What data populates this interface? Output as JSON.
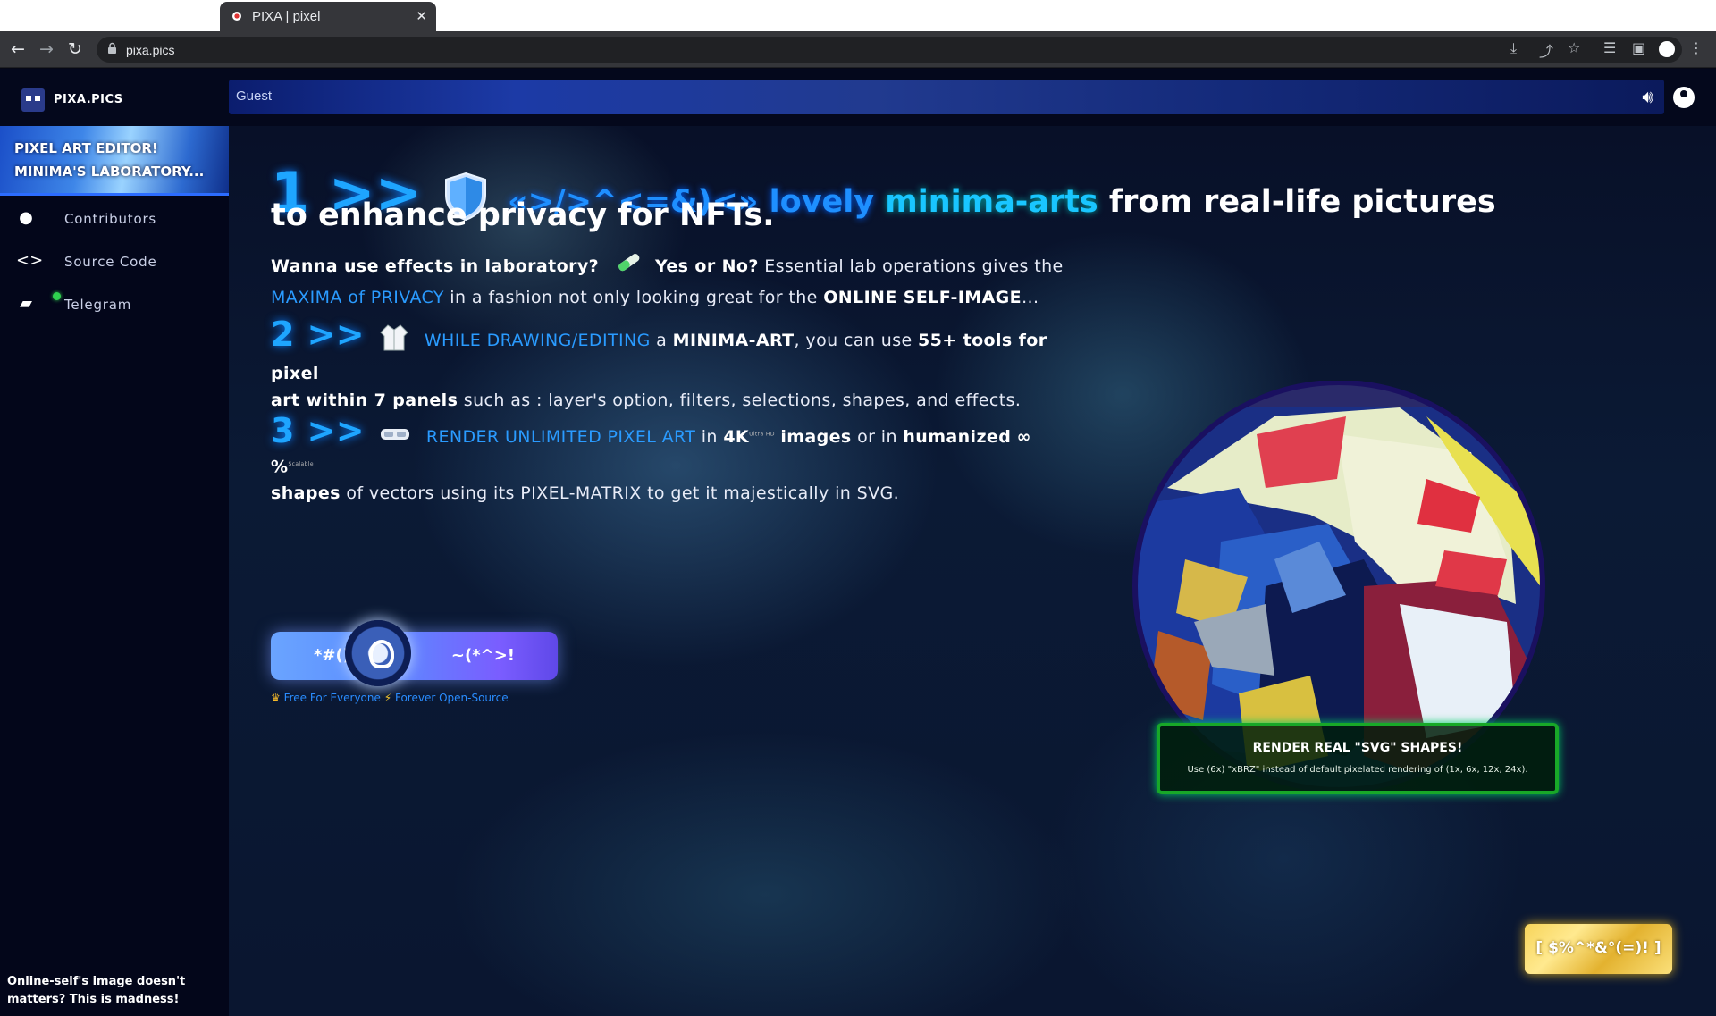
{
  "browser": {
    "tab_title": "PIXA | pixel",
    "url": "pixa.pics"
  },
  "header": {
    "brand": "PIXA.PICS",
    "user_name": "Guest"
  },
  "sidebar": {
    "promo_line1": "PIXEL ART EDITOR!",
    "promo_line2": "MINIMA'S LABORATORY...",
    "items": [
      {
        "label": "Contributors",
        "icon": "person-icon"
      },
      {
        "label": "Source Code",
        "icon": "code-icon"
      },
      {
        "label": "Telegram",
        "icon": "chat-icon"
      }
    ],
    "footer_quote": "Online-self's image doesn't matters? This is madness!"
  },
  "main": {
    "step1_num": "1 >>",
    "step1_code": "«>/>^<=&)<»",
    "step1_lovely": "lovely",
    "step1_minima": "minima-arts",
    "step1_rest": "from real-life pictures",
    "step1_line2": "to enhance privacy for NFTs.",
    "lab_q": "Wanna use effects in laboratory?",
    "lab_yesno": "Yes or No?",
    "lab_rest": "Essential lab operations gives the",
    "lab_maxima": "MAXIMA of PRIVACY",
    "lab_rest2": "in a fashion not only looking great for the",
    "lab_online": "ONLINE SELF-IMAGE",
    "lab_dots": "...",
    "step2_num": "2 >>",
    "step2_while": "WHILE DRAWING/EDITING",
    "step2_a": "a",
    "step2_minima": "MINIMA-ART",
    "step2_mid": ", you can use",
    "step2_tools": "55+ tools for pixel",
    "step2_art": "art within 7 panels",
    "step2_rest": "such as : layer's option, filters, selections, shapes, and effects.",
    "step3_num": "3 >>",
    "step3_render": "RENDER UNLIMITED PIXEL ART",
    "step3_in": "in",
    "step3_4k": "4K",
    "step3_4k_sup": "Ultra HD",
    "step3_images": "images",
    "step3_orin": "or in",
    "step3_humanized": "humanized",
    "step3_inf": "∞ %",
    "step3_inf_sup": "Scalable",
    "step3_shapes": "shapes",
    "step3_rest": "of vectors using its PIXEL-MATRIX to get it majestically in SVG.",
    "cta_left": "*#()&?",
    "cta_right": "~(*^>!",
    "tagline_free": "Free For Everyone",
    "tagline_open": "Forever Open-Source",
    "svg_title": "RENDER REAL \"SVG\" SHAPES!",
    "svg_sub": "Use (6x) \"xBRZ\" instead of default pixelated rendering of (1x, 6x, 12x, 24x).",
    "gold_label": "[ $%^*&°(=)! ]"
  },
  "colors": {
    "accent_blue": "#1e8fff",
    "success_green": "#18a828",
    "gold": "#f7d45a"
  }
}
